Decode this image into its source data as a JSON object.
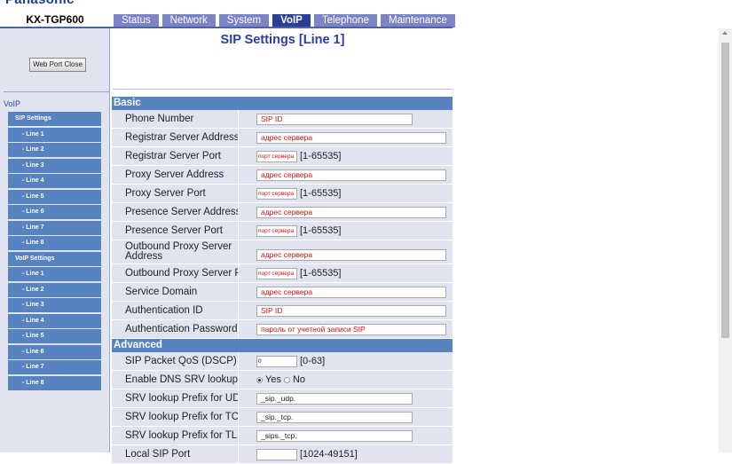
{
  "brand": "Panasonic",
  "model": "KX-TGP600",
  "nav_tabs": [
    "Status",
    "Network",
    "System",
    "VoIP",
    "Telephone",
    "Maintenance"
  ],
  "active_tab": "VoIP",
  "page_title": "SIP Settings [Line 1]",
  "web_port_close": "Web Port Close",
  "sidebar": {
    "section": "VoIP",
    "items": [
      {
        "label": "SIP Settings",
        "type": "head"
      },
      {
        "label": "- Line 1",
        "type": "sub"
      },
      {
        "label": "- Line 2",
        "type": "sub"
      },
      {
        "label": "- Line 3",
        "type": "sub"
      },
      {
        "label": "- Line 4",
        "type": "sub"
      },
      {
        "label": "- Line 5",
        "type": "sub"
      },
      {
        "label": "- Line 6",
        "type": "sub"
      },
      {
        "label": "- Line 7",
        "type": "sub"
      },
      {
        "label": "- Line 8",
        "type": "sub"
      },
      {
        "label": "VoIP Settings",
        "type": "head"
      },
      {
        "label": "- Line 1",
        "type": "sub"
      },
      {
        "label": "- Line 2",
        "type": "sub"
      },
      {
        "label": "- Line 3",
        "type": "sub"
      },
      {
        "label": "- Line 4",
        "type": "sub"
      },
      {
        "label": "- Line 5",
        "type": "sub"
      },
      {
        "label": "- Line 6",
        "type": "sub"
      },
      {
        "label": "- Line 7",
        "type": "sub"
      },
      {
        "label": "- Line 8",
        "type": "sub"
      }
    ]
  },
  "basic": {
    "header": "Basic",
    "rows": [
      {
        "label": "Phone Number",
        "value": "SIP ID",
        "size": "mid",
        "hint": ""
      },
      {
        "label": "Registrar Server Address",
        "value": "адрес сервера",
        "size": "wide",
        "hint": ""
      },
      {
        "label": "Registrar Server Port",
        "value": "порт сервера",
        "size": "small",
        "hint": "[1-65535]"
      },
      {
        "label": "Proxy Server Address",
        "value": "адрес сервера",
        "size": "wide",
        "hint": ""
      },
      {
        "label": "Proxy Server Port",
        "value": "порт сервера",
        "size": "small",
        "hint": "[1-65535]"
      },
      {
        "label": "Presence Server Address",
        "value": "адрес сервера",
        "size": "wide",
        "hint": ""
      },
      {
        "label": "Presence Server Port",
        "value": "порт сервера",
        "size": "small",
        "hint": "[1-65535]"
      },
      {
        "label": "Outbound Proxy Server Address",
        "value": "адрес сервера",
        "size": "wide",
        "hint": "",
        "tall": true
      },
      {
        "label": "Outbound Proxy Server Port",
        "value": "порт сервера",
        "size": "small",
        "hint": "[1-65535]"
      },
      {
        "label": "Service Domain",
        "value": "адрес сервера",
        "size": "wide",
        "hint": ""
      },
      {
        "label": "Authentication ID",
        "value": "SIP ID",
        "size": "wide",
        "hint": ""
      },
      {
        "label": "Authentication Password",
        "value": "пароль от учетной записи SIP",
        "size": "wide",
        "hint": ""
      }
    ]
  },
  "advanced": {
    "header": "Advanced",
    "rows": [
      {
        "label": "SIP Packet QoS (DSCP)",
        "value": "0",
        "size": "small",
        "hint": "[0-63]",
        "plain": true
      },
      {
        "label": "Enable DNS SRV lookup",
        "radio": true,
        "options": [
          "Yes",
          "No"
        ],
        "selected": "Yes"
      },
      {
        "label": "SRV lookup Prefix for UDP",
        "value": "_sip._udp.",
        "size": "mid",
        "hint": "",
        "plain": true
      },
      {
        "label": "SRV lookup Prefix for TCP",
        "value": "_sip._tcp.",
        "size": "mid",
        "hint": "",
        "plain": true
      },
      {
        "label": "SRV lookup Prefix for TLS",
        "value": "_sips._tcp.",
        "size": "mid",
        "hint": "",
        "plain": true
      },
      {
        "label": "Local SIP Port",
        "value": "",
        "size": "small",
        "hint": "[1024-49151]",
        "plain": true
      }
    ]
  }
}
